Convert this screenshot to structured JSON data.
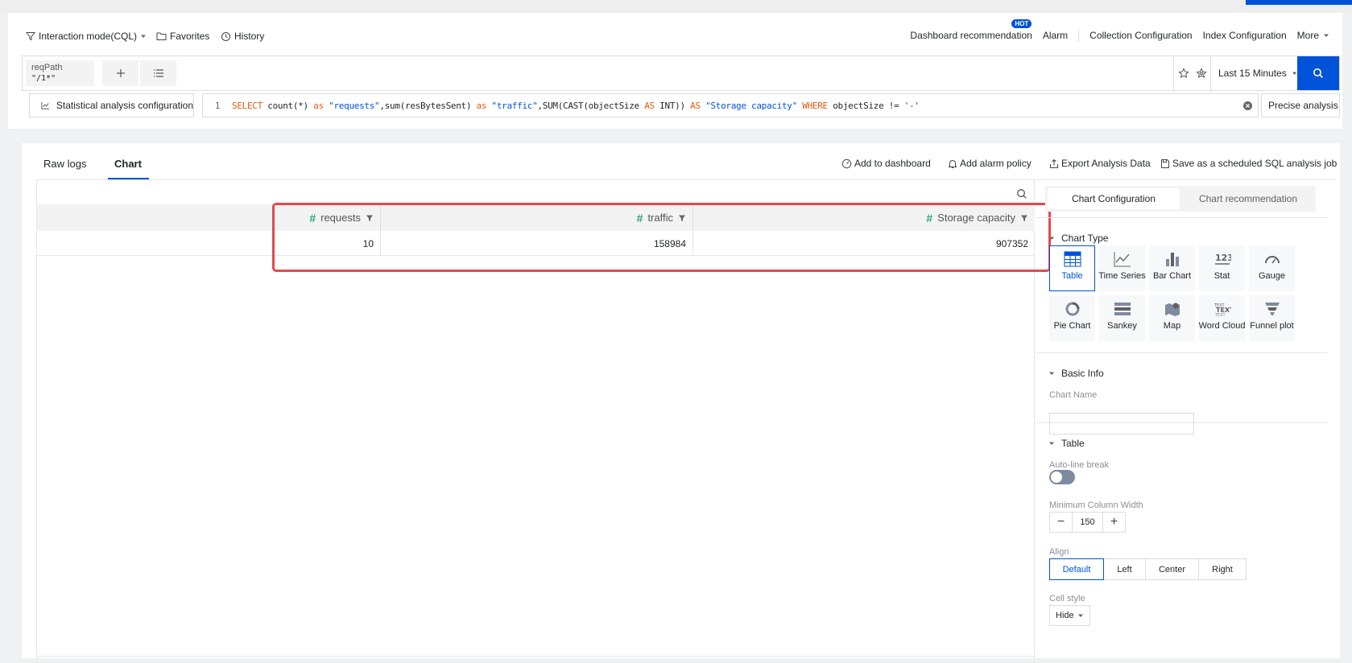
{
  "toolbar": {
    "mode_label": "Interaction mode(CQL)",
    "favorites_label": "Favorites",
    "history_label": "History",
    "dashboard_rec_label": "Dashboard recommendation",
    "hot_badge": "HOT",
    "alarm_label": "Alarm",
    "collection_config_label": "Collection Configuration",
    "index_config_label": "Index Configuration",
    "more_label": "More"
  },
  "query": {
    "tag_key": "reqPath",
    "tag_value": "\"/1*\"",
    "time_range": "Last 15 Minutes",
    "stat_config_label": "Statistical analysis configuration",
    "sql_line_no": "1",
    "sql_tokens": [
      {
        "t": "SELECT",
        "c": "kw"
      },
      {
        "t": " count(*) ",
        "c": ""
      },
      {
        "t": "as",
        "c": "kw"
      },
      {
        "t": " ",
        "c": ""
      },
      {
        "t": "\"requests\"",
        "c": "str"
      },
      {
        "t": ",sum(resBytesSent) ",
        "c": ""
      },
      {
        "t": "as",
        "c": "kw"
      },
      {
        "t": " ",
        "c": ""
      },
      {
        "t": "\"traffic\"",
        "c": "str"
      },
      {
        "t": ",SUM(CAST(objectSize ",
        "c": ""
      },
      {
        "t": "AS",
        "c": "kw"
      },
      {
        "t": " INT)) ",
        "c": ""
      },
      {
        "t": "AS",
        "c": "kw"
      },
      {
        "t": " ",
        "c": ""
      },
      {
        "t": "\"Storage capacity\"",
        "c": "str"
      },
      {
        "t": " ",
        "c": ""
      },
      {
        "t": "WHERE",
        "c": "kw"
      },
      {
        "t": " objectSize != ",
        "c": ""
      },
      {
        "t": "'-'",
        "c": "str"
      }
    ],
    "mode_select": "Precise analysis"
  },
  "result": {
    "tabs": [
      "Raw logs",
      "Chart"
    ],
    "actions": {
      "add_dashboard": "Add to dashboard",
      "add_alarm": "Add alarm policy",
      "export": "Export Analysis Data",
      "save_job": "Save as a scheduled SQL analysis job"
    },
    "columns": [
      "requests",
      "traffic",
      "Storage capacity"
    ],
    "rows": [
      [
        "10",
        "158984",
        "907352"
      ]
    ]
  },
  "config": {
    "tabs": [
      "Chart Configuration",
      "Chart recommendation"
    ],
    "chart_type_title": "Chart Type",
    "chart_types": [
      "Table",
      "Time Series",
      "Bar Chart",
      "Stat",
      "Gauge",
      "Pie Chart",
      "Sankey",
      "Map",
      "Word Cloud",
      "Funnel plot"
    ],
    "selected_chart_type": "Table",
    "basic_info_title": "Basic Info",
    "chart_name_label": "Chart Name",
    "chart_name_value": "",
    "table_title": "Table",
    "auto_line_break_label": "Auto-line break",
    "auto_line_break_on": false,
    "min_col_width_label": "Minimum Column Width",
    "min_col_width_value": "150",
    "align_label": "Align",
    "align_options": [
      "Default",
      "Left",
      "Center",
      "Right"
    ],
    "align_selected": "Default",
    "cell_style_label": "Cell style",
    "cell_style_value": "Hide"
  },
  "colors": {
    "accent": "#0052d9",
    "highlight": "#e5484d",
    "numeric_hash": "#2ba471"
  }
}
